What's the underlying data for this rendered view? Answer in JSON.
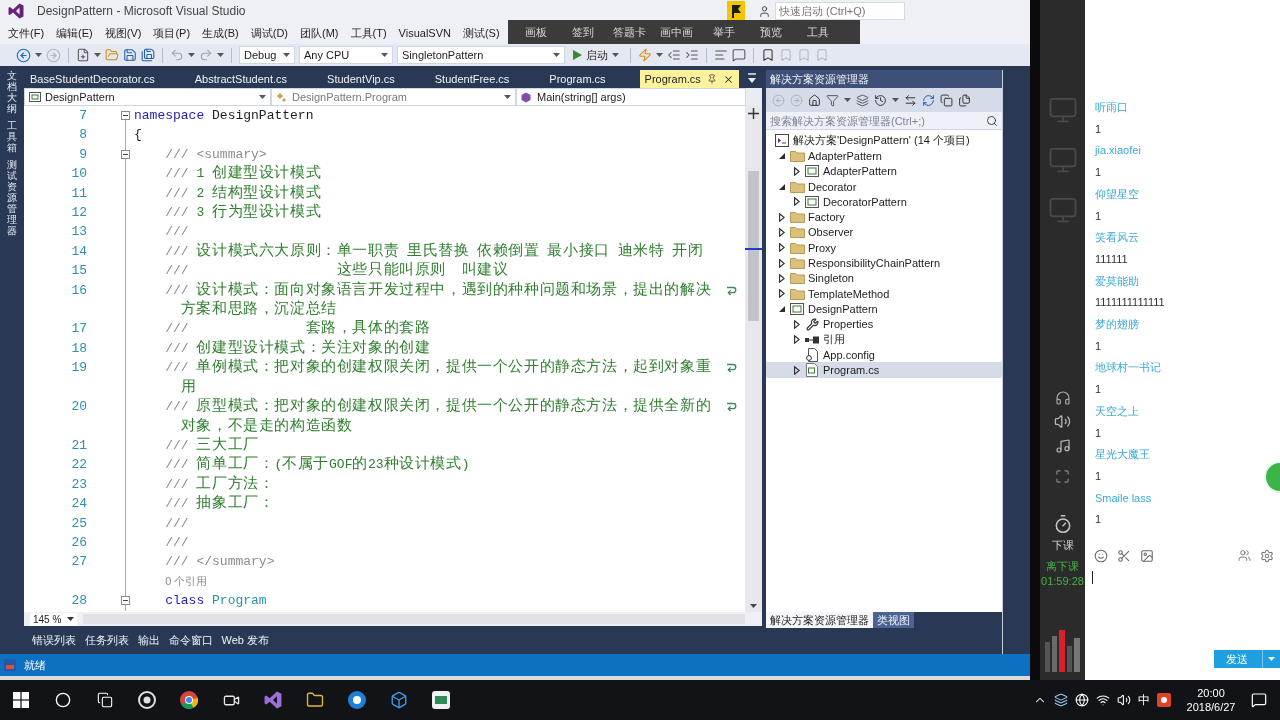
{
  "window": {
    "title": "DesignPattern - Microsoft Visual Studio",
    "quick_launch": {
      "placeholder": "快速启动 (Ctrl+Q)"
    }
  },
  "menu": [
    "文件(F)",
    "编辑(E)",
    "视图(V)",
    "项目(P)",
    "生成(B)",
    "调试(D)",
    "团队(M)",
    "工具(T)",
    "VisualSVN",
    "测试(S)"
  ],
  "classroom_toolbar": [
    "画板",
    "签到",
    "答题卡",
    "画中画",
    "举手",
    "预览",
    "工具"
  ],
  "toolbar": {
    "configuration": "Debug",
    "platform": "Any CPU",
    "startup_project": "SingletonPattern",
    "start_button": "启动"
  },
  "side_tabs": [
    "文档大纲",
    "工具箱",
    "测试资源管理器"
  ],
  "document_tabs": [
    {
      "label": "BaseStudentDecorator.cs",
      "selected": false
    },
    {
      "label": "AbstractStudent.cs",
      "selected": false
    },
    {
      "label": "StudentVip.cs",
      "selected": false
    },
    {
      "label": "StudentFree.cs",
      "selected": false
    },
    {
      "label": "Program.cs",
      "selected": false
    },
    {
      "label": "Program.cs",
      "selected": true
    }
  ],
  "navigation_bar": {
    "project": "DesignPattern",
    "type": "DesignPattern.Program",
    "member": "Main(string[] args)"
  },
  "code_lines": [
    {
      "kind": "code",
      "number": "7",
      "expanded": true,
      "segments": [
        {
          "kind": "keyword",
          "text": "namespace"
        },
        {
          "kind": "identifier",
          "text": "DesignPattern"
        }
      ]
    },
    {
      "kind": "code",
      "number": "8",
      "segments": [
        {
          "kind": "punctuation",
          "text": "{"
        }
      ],
      "children": [
        {
          "kind": "code",
          "number": "9",
          "expanded": true,
          "segments": [
            {
              "kind": "doc_delimiter",
              "text": "///"
            },
            {
              "kind": "doc_tag",
              "text": "<summary>"
            }
          ]
        },
        {
          "kind": "code",
          "number": "10",
          "segments": [
            {
              "kind": "doc_delimiter",
              "text": "///"
            },
            {
              "kind": "comment",
              "text": "1 创建型设计模式"
            }
          ]
        },
        {
          "kind": "code",
          "number": "11",
          "segments": [
            {
              "kind": "doc_delimiter",
              "text": "///"
            },
            {
              "kind": "comment",
              "text": "2 结构型设计模式"
            }
          ]
        },
        {
          "kind": "code",
          "number": "12",
          "segments": [
            {
              "kind": "doc_delimiter",
              "text": "///"
            },
            {
              "kind": "comment",
              "text": "3 行为型设计模式"
            }
          ]
        },
        {
          "kind": "code",
          "number": "13",
          "segments": [
            {
              "kind": "doc_delimiter",
              "text": "///"
            }
          ]
        },
        {
          "kind": "code",
          "number": "14",
          "segments": [
            {
              "kind": "doc_delimiter",
              "text": "///"
            },
            {
              "kind": "comment",
              "text": "设计模式六大原则：单一职责 里氏替换 依赖倒置 最小接口 迪米特 开闭"
            }
          ]
        },
        {
          "kind": "code",
          "number": "15",
          "segments": [
            {
              "kind": "doc_delimiter",
              "text": "///"
            },
            {
              "kind": "comment",
              "text": "                  这些只能叫原则  叫建议"
            }
          ]
        },
        {
          "kind": "code",
          "number": "16",
          "segments": [
            {
              "kind": "doc_delimiter",
              "text": "///"
            },
            {
              "kind": "comment",
              "text": "设计模式：面向对象语言开发过程中，遇到的种种问题和场景，提出的解决方案和思路，沉淀总结"
            }
          ]
        },
        {
          "kind": "code",
          "number": "17",
          "segments": [
            {
              "kind": "doc_delimiter",
              "text": "///"
            },
            {
              "kind": "comment",
              "text": "              套路，具体的套路"
            }
          ]
        },
        {
          "kind": "code",
          "number": "18",
          "segments": [
            {
              "kind": "doc_delimiter",
              "text": "///"
            },
            {
              "kind": "comment",
              "text": "创建型设计模式：关注对象的创建"
            }
          ]
        },
        {
          "kind": "code",
          "number": "19",
          "segments": [
            {
              "kind": "doc_delimiter",
              "text": "///"
            },
            {
              "kind": "comment",
              "text": "单例模式：把对象的创建权限关闭，提供一个公开的静态方法，起到对象重用"
            }
          ]
        },
        {
          "kind": "code",
          "number": "20",
          "segments": [
            {
              "kind": "doc_delimiter",
              "text": "///"
            },
            {
              "kind": "comment",
              "text": "原型模式：把对象的创建权限关闭，提供一个公开的静态方法，提供全新的对象，不是走的构造函数"
            }
          ]
        },
        {
          "kind": "code",
          "number": "21",
          "segments": [
            {
              "kind": "doc_delimiter",
              "text": "///"
            },
            {
              "kind": "comment",
              "text": "三大工厂"
            }
          ]
        },
        {
          "kind": "code",
          "number": "22",
          "segments": [
            {
              "kind": "doc_delimiter",
              "text": "///"
            },
            {
              "kind": "comment",
              "text": "简单工厂：(不属于GOF的23种设计模式)"
            }
          ]
        },
        {
          "kind": "code",
          "number": "23",
          "segments": [
            {
              "kind": "doc_delimiter",
              "text": "///"
            },
            {
              "kind": "comment",
              "text": "工厂方法："
            }
          ]
        },
        {
          "kind": "code",
          "number": "24",
          "segments": [
            {
              "kind": "doc_delimiter",
              "text": "///"
            },
            {
              "kind": "comment",
              "text": "抽象工厂："
            }
          ]
        },
        {
          "kind": "code",
          "number": "25",
          "segments": [
            {
              "kind": "doc_delimiter",
              "text": "///"
            }
          ]
        },
        {
          "kind": "code",
          "number": "26",
          "segments": [
            {
              "kind": "doc_delimiter",
              "text": "///"
            }
          ]
        },
        {
          "kind": "code",
          "number": "27",
          "segments": [
            {
              "kind": "doc_delimiter",
              "text": "///"
            },
            {
              "kind": "doc_tag",
              "text": "</summary>"
            }
          ]
        },
        {
          "kind": "codelens",
          "text": "0 个引用"
        },
        {
          "kind": "code",
          "number": "28",
          "expanded": true,
          "segments": [
            {
              "kind": "keyword",
              "text": "class"
            },
            {
              "kind": "type",
              "text": "Program"
            }
          ]
        }
      ]
    }
  ],
  "editor_zoom": "145 %",
  "tool_window_tabs": [
    "错误列表",
    "任务列表",
    "输出",
    "命令窗口",
    "Web 发布"
  ],
  "status_bar": {
    "text": "就绪"
  },
  "solution_explorer": {
    "title": "解决方案资源管理器",
    "search": {
      "placeholder": "搜索解决方案资源管理器(Ctrl+;)"
    },
    "tree": [
      {
        "kind": "solution",
        "label": "解决方案'DesignPattern' (14 个项目)",
        "selected": false,
        "children": [
          {
            "kind": "folder",
            "label": "AdapterPattern",
            "expanded": true,
            "selected": false,
            "children": [
              {
                "kind": "project",
                "label": "AdapterPattern",
                "expanded": false,
                "selected": false
              }
            ]
          },
          {
            "kind": "folder",
            "label": "Decorator",
            "expanded": true,
            "selected": false,
            "children": [
              {
                "kind": "project",
                "label": "DecoratorPattern",
                "expanded": false,
                "selected": false
              }
            ]
          },
          {
            "kind": "folder",
            "label": "Factory",
            "expanded": false,
            "selected": false
          },
          {
            "kind": "folder",
            "label": "Observer",
            "expanded": false,
            "selected": false
          },
          {
            "kind": "folder",
            "label": "Proxy",
            "expanded": false,
            "selected": false
          },
          {
            "kind": "folder",
            "label": "ResponsibilityChainPattern",
            "expanded": false,
            "selected": false
          },
          {
            "kind": "folder",
            "label": "Singleton",
            "expanded": false,
            "selected": false
          },
          {
            "kind": "folder",
            "label": "TemplateMethod",
            "expanded": false,
            "selected": false
          },
          {
            "kind": "project",
            "label": "DesignPattern",
            "expanded": true,
            "selected": false,
            "children": [
              {
                "kind": "properties",
                "label": "Properties",
                "expanded": false,
                "selected": false
              },
              {
                "kind": "references",
                "label": "引用",
                "expanded": false,
                "selected": false
              },
              {
                "kind": "config",
                "label": "App.config",
                "selected": false
              },
              {
                "kind": "file",
                "label": "Program.cs",
                "expanded": false,
                "selected": true
              }
            ]
          }
        ]
      }
    ],
    "tabs": [
      {
        "label": "解决方案资源管理器",
        "selected": true
      },
      {
        "label": "类视图",
        "selected": false
      }
    ]
  },
  "classroom": {
    "end_class_button": "下课",
    "countdown_label": "离下课",
    "countdown": "01:59:28"
  },
  "chat": {
    "messages": [
      {
        "user": "听雨口",
        "text": "1"
      },
      {
        "user": "jia.xiaofei",
        "text": "1"
      },
      {
        "user": "仰望星空",
        "text": "1"
      },
      {
        "user": "笑看风云",
        "text": "111111"
      },
      {
        "user": "爱莫能助",
        "text": "1111111111111"
      },
      {
        "user": "梦的翅膀",
        "text": "1"
      },
      {
        "user": "地球村一书记",
        "text": "1"
      },
      {
        "user": "天空之上",
        "text": "1"
      },
      {
        "user": "星光大魔王",
        "text": "1"
      },
      {
        "user": "Smaile lass",
        "text": "1"
      }
    ],
    "send_button": "发送"
  },
  "taskbar": {
    "input_method": "中",
    "time": "20:00",
    "date": "2018/6/27"
  }
}
